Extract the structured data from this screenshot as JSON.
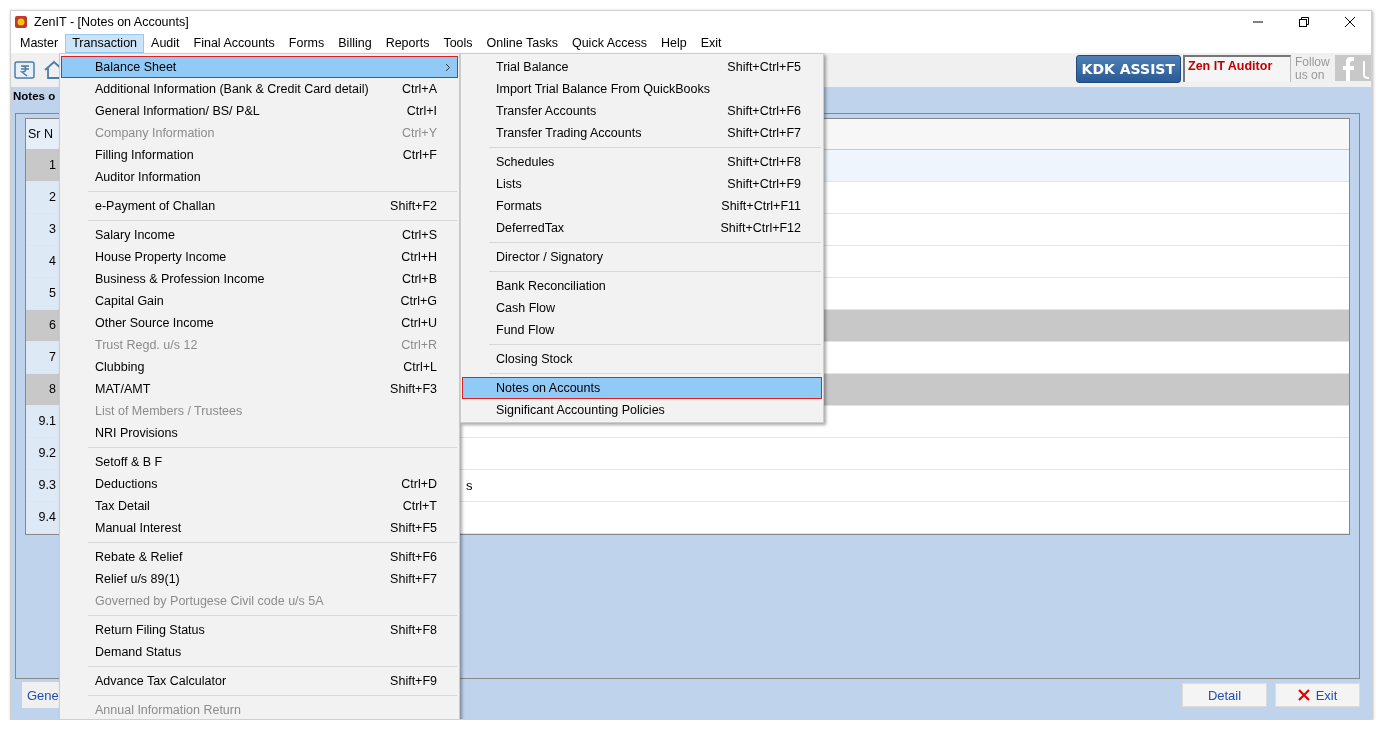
{
  "window": {
    "title": "ZenIT - [Notes on Accounts]"
  },
  "menu_bar": [
    {
      "label": "Master",
      "selected": false
    },
    {
      "label": "Transaction",
      "selected": true
    },
    {
      "label": "Audit",
      "selected": false
    },
    {
      "label": "Final Accounts",
      "selected": false
    },
    {
      "label": "Forms",
      "selected": false
    },
    {
      "label": "Billing",
      "selected": false
    },
    {
      "label": "Reports",
      "selected": false
    },
    {
      "label": "Tools",
      "selected": false
    },
    {
      "label": "Online Tasks",
      "selected": false
    },
    {
      "label": "Quick Access",
      "selected": false
    },
    {
      "label": "Help",
      "selected": false
    },
    {
      "label": "Exit",
      "selected": false
    }
  ],
  "toolbar": {
    "kdk_button": "KDK ASSIST",
    "product_label": "Zen IT Auditor",
    "follow_text": "Follow us on"
  },
  "page_label": "Notes o",
  "table": {
    "columns": [
      "Sr N"
    ],
    "rows": [
      {
        "sr": "1",
        "kind": "row",
        "selected": true
      },
      {
        "sr": "2",
        "kind": "row",
        "selected": false
      },
      {
        "sr": "3",
        "kind": "row",
        "selected": false
      },
      {
        "sr": "4",
        "kind": "row",
        "selected": false
      },
      {
        "sr": "5",
        "kind": "row",
        "selected": false
      },
      {
        "sr": "6",
        "kind": "group",
        "selected": false
      },
      {
        "sr": "7",
        "kind": "row",
        "selected": false
      },
      {
        "sr": "8",
        "kind": "group",
        "selected": false
      },
      {
        "sr": "9.1",
        "kind": "row",
        "selected": false
      },
      {
        "sr": "9.2",
        "kind": "row",
        "selected": false
      },
      {
        "sr": "9.3",
        "kind": "row",
        "selected": false,
        "column_2": "s"
      },
      {
        "sr": "9.4",
        "kind": "row",
        "selected": false
      }
    ]
  },
  "bottom_tab": "Gene",
  "buttons": [
    {
      "label": "Detail",
      "kind": "plain"
    },
    {
      "label": "Exit",
      "kind": "exit"
    }
  ],
  "menu": [
    {
      "kind": "item",
      "label": "Balance Sheet",
      "submenu": true,
      "selected": true,
      "disabled": false
    },
    {
      "kind": "item",
      "label": "Additional Information (Bank & Credit Card detail)",
      "shortcut": "Ctrl+A",
      "selected": false,
      "disabled": false
    },
    {
      "kind": "item",
      "label": "General Information/ BS/ P&L",
      "shortcut": "Ctrl+I",
      "selected": false,
      "disabled": false
    },
    {
      "kind": "item",
      "label": "Company Information",
      "shortcut": "Ctrl+Y",
      "selected": false,
      "disabled": true
    },
    {
      "kind": "item",
      "label": "Filling Information",
      "shortcut": "Ctrl+F",
      "selected": false,
      "disabled": false
    },
    {
      "kind": "item",
      "label": "Auditor Information",
      "selected": false,
      "disabled": false
    },
    {
      "kind": "separator"
    },
    {
      "kind": "item",
      "label": "e-Payment of Challan",
      "shortcut": "Shift+F2",
      "selected": false,
      "disabled": false
    },
    {
      "kind": "separator"
    },
    {
      "kind": "item",
      "label": "Salary Income",
      "shortcut": "Ctrl+S",
      "selected": false,
      "disabled": false
    },
    {
      "kind": "item",
      "label": "House Property Income",
      "shortcut": "Ctrl+H",
      "selected": false,
      "disabled": false
    },
    {
      "kind": "item",
      "label": "Business & Profession Income",
      "shortcut": "Ctrl+B",
      "selected": false,
      "disabled": false
    },
    {
      "kind": "item",
      "label": "Capital Gain",
      "shortcut": "Ctrl+G",
      "selected": false,
      "disabled": false
    },
    {
      "kind": "item",
      "label": "Other Source Income",
      "shortcut": "Ctrl+U",
      "selected": false,
      "disabled": false
    },
    {
      "kind": "item",
      "label": "Trust Regd. u/s 12",
      "shortcut": "Ctrl+R",
      "selected": false,
      "disabled": true
    },
    {
      "kind": "item",
      "label": "Clubbing",
      "shortcut": "Ctrl+L",
      "selected": false,
      "disabled": false
    },
    {
      "kind": "item",
      "label": "MAT/AMT",
      "shortcut": "Shift+F3",
      "selected": false,
      "disabled": false
    },
    {
      "kind": "item",
      "label": "List of Members / Trustees",
      "selected": false,
      "disabled": true
    },
    {
      "kind": "item",
      "label": "NRI Provisions",
      "selected": false,
      "disabled": false
    },
    {
      "kind": "separator"
    },
    {
      "kind": "item",
      "label": "Setoff & B F",
      "selected": false,
      "disabled": false
    },
    {
      "kind": "item",
      "label": "Deductions",
      "shortcut": "Ctrl+D",
      "selected": false,
      "disabled": false
    },
    {
      "kind": "item",
      "label": "Tax Detail",
      "shortcut": "Ctrl+T",
      "selected": false,
      "disabled": false
    },
    {
      "kind": "item",
      "label": "Manual Interest",
      "shortcut": "Shift+F5",
      "selected": false,
      "disabled": false
    },
    {
      "kind": "separator"
    },
    {
      "kind": "item",
      "label": "Rebate & Relief",
      "shortcut": "Shift+F6",
      "selected": false,
      "disabled": false
    },
    {
      "kind": "item",
      "label": "Relief u/s 89(1)",
      "shortcut": "Shift+F7",
      "selected": false,
      "disabled": false
    },
    {
      "kind": "item",
      "label": "Governed by Portugese Civil code u/s 5A",
      "selected": false,
      "disabled": true
    },
    {
      "kind": "separator"
    },
    {
      "kind": "item",
      "label": "Return Filing Status",
      "shortcut": "Shift+F8",
      "selected": false,
      "disabled": false
    },
    {
      "kind": "item",
      "label": "Demand Status",
      "selected": false,
      "disabled": false
    },
    {
      "kind": "separator"
    },
    {
      "kind": "item",
      "label": "Advance Tax Calculator",
      "shortcut": "Shift+F9",
      "selected": false,
      "disabled": false
    },
    {
      "kind": "separator"
    },
    {
      "kind": "item",
      "label": "Annual Information Return",
      "selected": false,
      "disabled": true
    }
  ],
  "submenu": [
    {
      "kind": "item",
      "label": "Trial Balance",
      "shortcut": "Shift+Ctrl+F5",
      "selected": false
    },
    {
      "kind": "item",
      "label": "Import Trial Balance From QuickBooks",
      "selected": false
    },
    {
      "kind": "item",
      "label": "Transfer Accounts",
      "shortcut": "Shift+Ctrl+F6",
      "selected": false
    },
    {
      "kind": "item",
      "label": "Transfer Trading Accounts",
      "shortcut": "Shift+Ctrl+F7",
      "selected": false
    },
    {
      "kind": "separator"
    },
    {
      "kind": "item",
      "label": "Schedules",
      "shortcut": "Shift+Ctrl+F8",
      "selected": false
    },
    {
      "kind": "item",
      "label": "Lists",
      "shortcut": "Shift+Ctrl+F9",
      "selected": false
    },
    {
      "kind": "item",
      "label": "Formats",
      "shortcut": "Shift+Ctrl+F11",
      "selected": false
    },
    {
      "kind": "item",
      "label": "DeferredTax",
      "shortcut": "Shift+Ctrl+F12",
      "selected": false
    },
    {
      "kind": "separator"
    },
    {
      "kind": "item",
      "label": "Director / Signatory",
      "selected": false
    },
    {
      "kind": "separator"
    },
    {
      "kind": "item",
      "label": "Bank Reconciliation",
      "selected": false
    },
    {
      "kind": "item",
      "label": "Cash Flow",
      "selected": false
    },
    {
      "kind": "item",
      "label": "Fund Flow",
      "selected": false
    },
    {
      "kind": "separator"
    },
    {
      "kind": "item",
      "label": "Closing Stock",
      "selected": false
    },
    {
      "kind": "separator"
    },
    {
      "kind": "item",
      "label": "Notes on Accounts",
      "selected": true
    },
    {
      "kind": "item",
      "label": "Significant Accounting Policies",
      "selected": false
    }
  ]
}
